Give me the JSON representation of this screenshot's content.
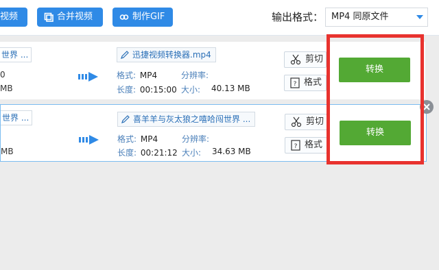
{
  "toolbar": {
    "btn1_label": "视频",
    "btn2_label": "合并视频",
    "btn3_label": "制作GIF",
    "format_label": "输出格式：",
    "format_value": "MP4  同原文件"
  },
  "rows": [
    {
      "src_name": "世界 ...",
      "src_line1": "0",
      "src_line2": "MB",
      "dst_name": "迅捷视频转换器.mp4",
      "format_key": "格式:",
      "format_val": "MP4",
      "res_key": "分辨率:",
      "length_key": "长度:",
      "length_val": "00:15:00",
      "size_key": "大小:",
      "size_val": "40.13 MB",
      "cut_label": "剪切",
      "fmt_label": "格式",
      "convert_label": "转换"
    },
    {
      "src_name": "世界 ...",
      "src_line1": "",
      "src_line2": "MB",
      "dst_name": "喜羊羊与灰太狼之嘻哈闯世界 ...",
      "format_key": "格式:",
      "format_val": "MP4",
      "res_key": "分辨率:",
      "length_key": "长度:",
      "length_val": "00:21:12",
      "size_key": "大小:",
      "size_val": "34.63 MB",
      "cut_label": "剪切",
      "fmt_label": "格式",
      "convert_label": "转换"
    }
  ],
  "colors": {
    "accent": "#2f8ae6",
    "convert": "#53a934",
    "highlight": "#e8322e"
  }
}
